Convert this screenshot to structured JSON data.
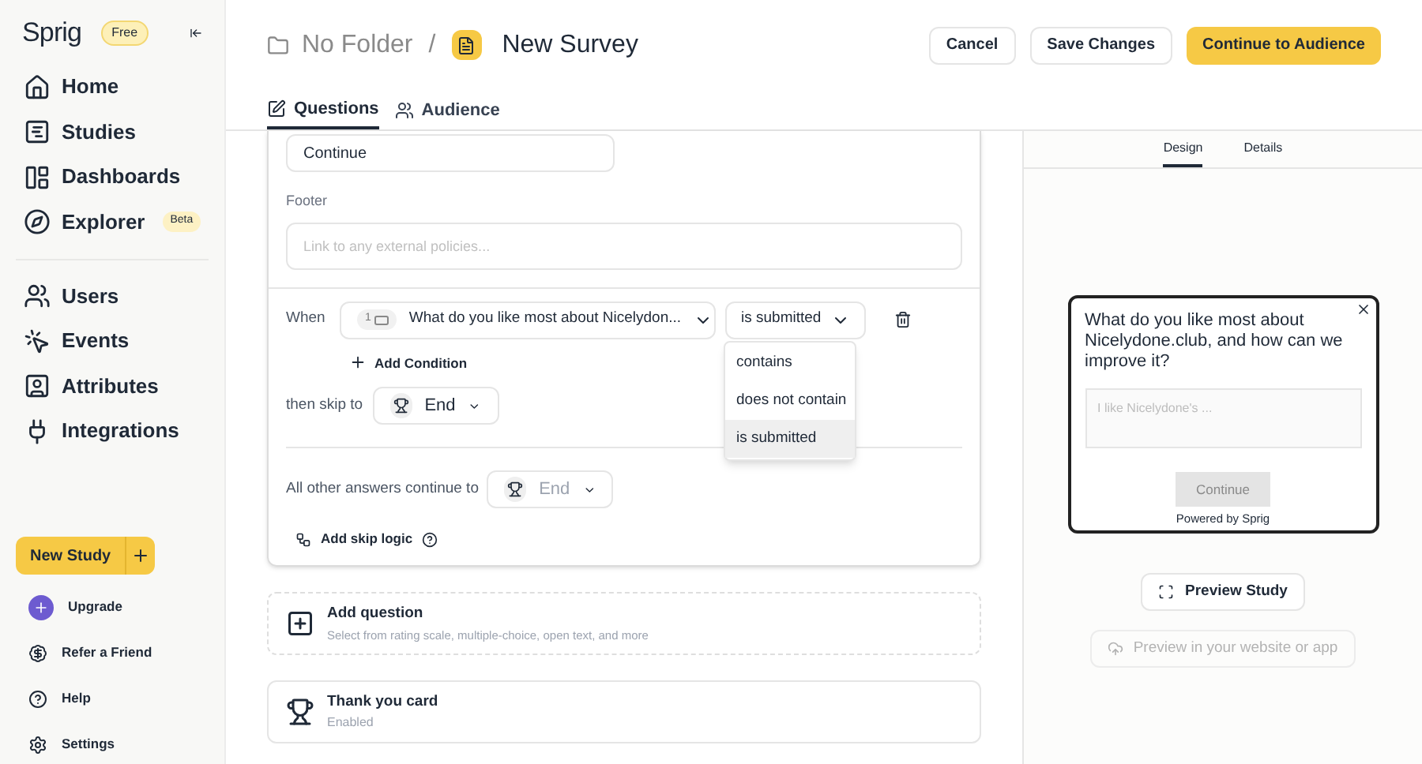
{
  "sidebar": {
    "logo": "Sprig",
    "plan_badge": "Free",
    "nav": [
      {
        "label": "Home",
        "selected": false
      },
      {
        "label": "Studies",
        "selected": false
      },
      {
        "label": "Dashboards",
        "selected": false
      },
      {
        "label": "Explorer",
        "badge": "Beta",
        "selected": false
      }
    ],
    "nav_secondary": [
      {
        "label": "Users",
        "selected": false
      },
      {
        "label": "Events",
        "selected": false
      },
      {
        "label": "Attributes",
        "selected": false
      },
      {
        "label": "Integrations",
        "selected": false
      }
    ],
    "new_study_button": "New Study",
    "footer": [
      {
        "label": "Upgrade"
      },
      {
        "label": "Refer a Friend"
      },
      {
        "label": "Help"
      },
      {
        "label": "Settings"
      }
    ]
  },
  "header": {
    "folder": "No Folder",
    "separator": "/",
    "title": "New Survey",
    "buttons": [
      {
        "label": "Cancel",
        "kind": "secondary"
      },
      {
        "label": "Save Changes",
        "kind": "secondary"
      },
      {
        "label": "Continue to Audience",
        "kind": "primary"
      }
    ]
  },
  "tabs": [
    {
      "label": "Questions",
      "selected": true
    },
    {
      "label": "Audience",
      "selected": false
    }
  ],
  "editor": {
    "button_text_value": "Continue",
    "footer_label": "Footer",
    "footer_placeholder": "Link to any external policies...",
    "rule": {
      "when_label": "When",
      "question_number": "1",
      "question": "What do you like most about Nicelydon...",
      "operator": "is submitted",
      "add_condition": "Add Condition",
      "skip_label": "then skip to",
      "skip_target": "End"
    },
    "operator_menu": [
      {
        "label": "contains",
        "selected": false
      },
      {
        "label": "does not contain",
        "selected": false
      },
      {
        "label": "is submitted",
        "selected": true
      }
    ],
    "other_label": "All other answers continue to",
    "other_target": "End",
    "add_skip_logic": "Add skip logic"
  },
  "add_question": {
    "title": "Add question",
    "subtitle": "Select from rating scale, multiple-choice, open text, and more"
  },
  "thank_you": {
    "title": "Thank you card",
    "status": "Enabled"
  },
  "preview": {
    "tabs": [
      {
        "label": "Design",
        "selected": true
      },
      {
        "label": "Details",
        "selected": false
      }
    ],
    "question": "What do you like most about Nicelydone.club, and how can we improve it?",
    "placeholder": "I like Nicelydone's ...",
    "continue": "Continue",
    "powered_by": "Powered by",
    "brand": "Sprig",
    "preview_button": "Preview Study",
    "website_button": "Preview in your website or app",
    "website_disabled": true
  }
}
